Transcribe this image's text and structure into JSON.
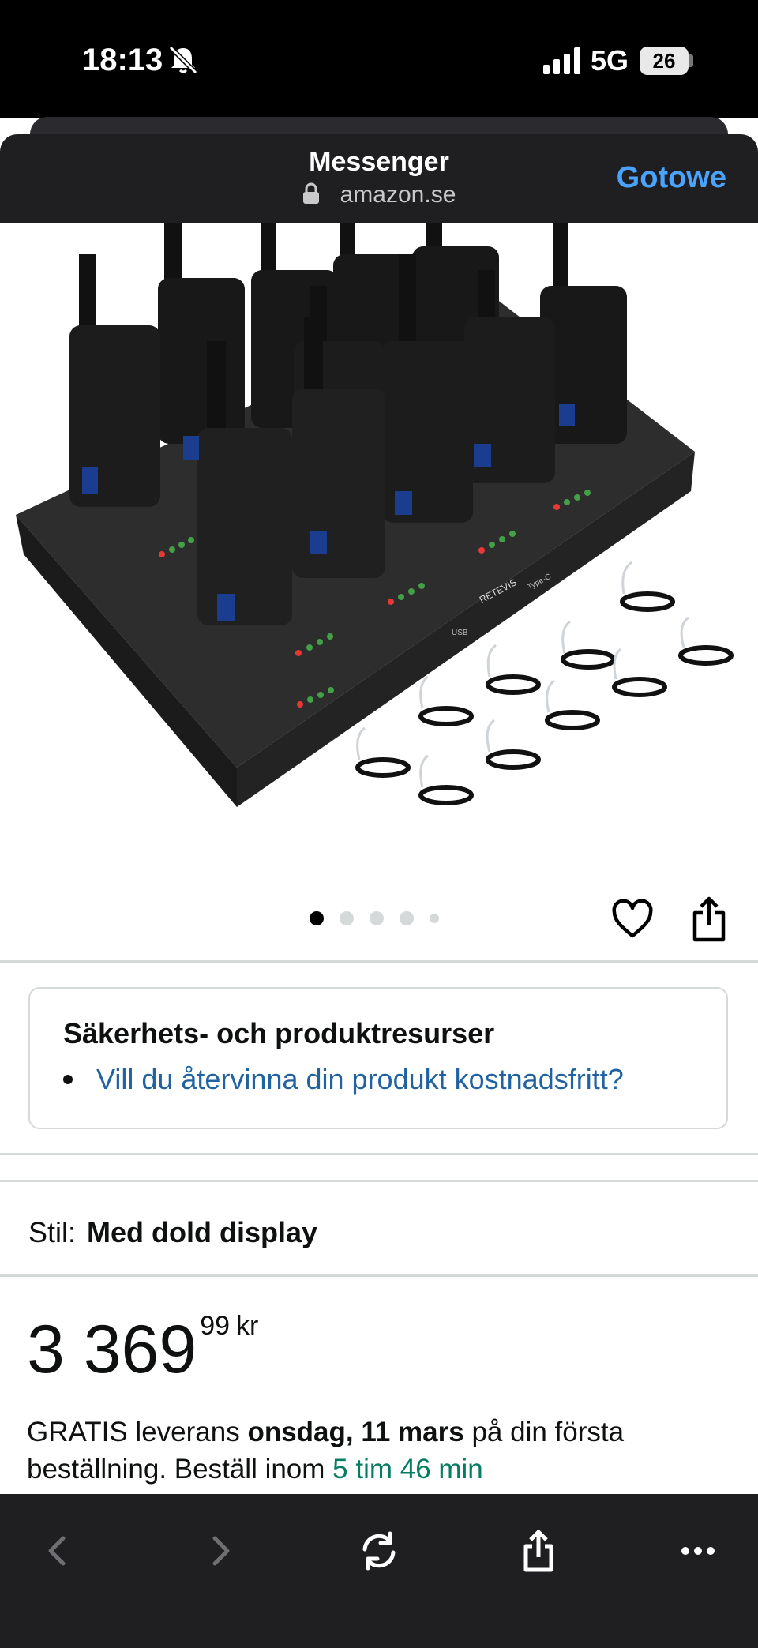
{
  "status": {
    "time": "18:13",
    "network": "5G",
    "battery": "26"
  },
  "header": {
    "title": "Messenger",
    "url": "amazon.se",
    "done_label": "Gotowe"
  },
  "hero": {
    "brand_text": "RETEVIS",
    "port_usb": "USB",
    "port_typec": "Type-C",
    "image_count": 5,
    "active_index": 0
  },
  "safety": {
    "title": "Säkerhets- och produktresurser",
    "link": "Vill du återvinna din produkt kostnadsfritt?"
  },
  "style": {
    "label": "Stil:",
    "value": "Med dold display"
  },
  "price": {
    "whole": "3 369",
    "fraction": "99",
    "currency": "kr"
  },
  "delivery": {
    "prefix": "GRATIS leverans ",
    "date": "onsdag, 11 mars",
    "middle": " på din första beställning. Beställ inom ",
    "countdown": "5 tim 46 min"
  },
  "icons": [
    "bell-slash-icon",
    "signal-icon",
    "lock-icon",
    "heart-icon",
    "share-icon",
    "back-icon",
    "forward-icon",
    "reload-icon",
    "toolbar-share-icon",
    "more-icon"
  ],
  "colors": {
    "link": "#2162a1",
    "done": "#4aa3ff",
    "countdown": "#067d62"
  }
}
